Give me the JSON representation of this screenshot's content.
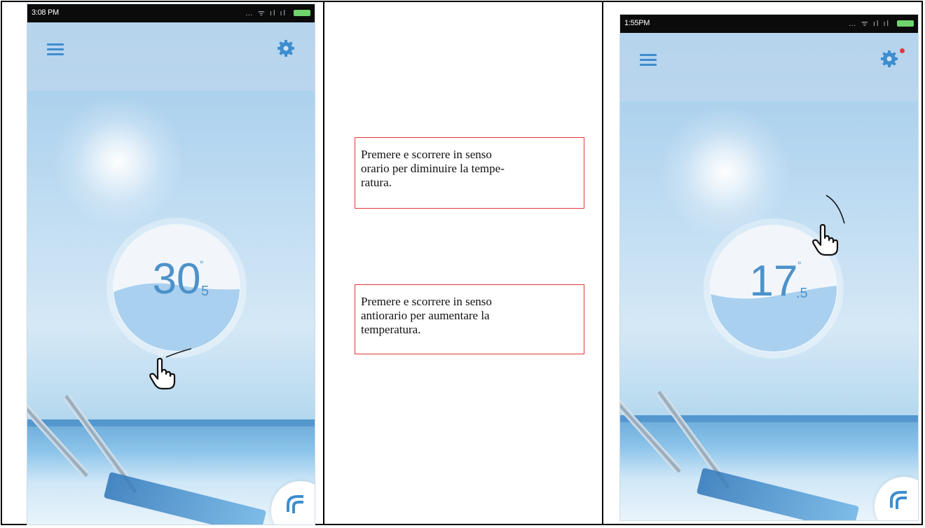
{
  "left_screen": {
    "status_time": "3:08 PM",
    "temperature": {
      "integer": "30",
      "degree": "°",
      "decimal": "5"
    }
  },
  "right_screen": {
    "status_time": "1:55PM",
    "temperature": {
      "integer": "17",
      "degree": "°",
      "decimal": ".5"
    }
  },
  "instructions": {
    "clockwise_line1": "Premere e scorrere in senso",
    "clockwise_line2": "orario per diminuire la tempe-",
    "clockwise_line3": "ratura.",
    "counterclockwise_line1": "Premere e scorrere in senso",
    "counterclockwise_line2": "antiorario per aumentare la",
    "counterclockwise_line3": "temperatura."
  },
  "icons": {
    "menu": "menu-icon",
    "settings": "gear-icon",
    "gesture": "hand-pointer-icon",
    "fab": "heat-pump-icon"
  },
  "colors": {
    "accent": "#3d8dcf",
    "water": "#a9d0ef",
    "callout_border": "#e23636",
    "notification": "#e5373b"
  }
}
